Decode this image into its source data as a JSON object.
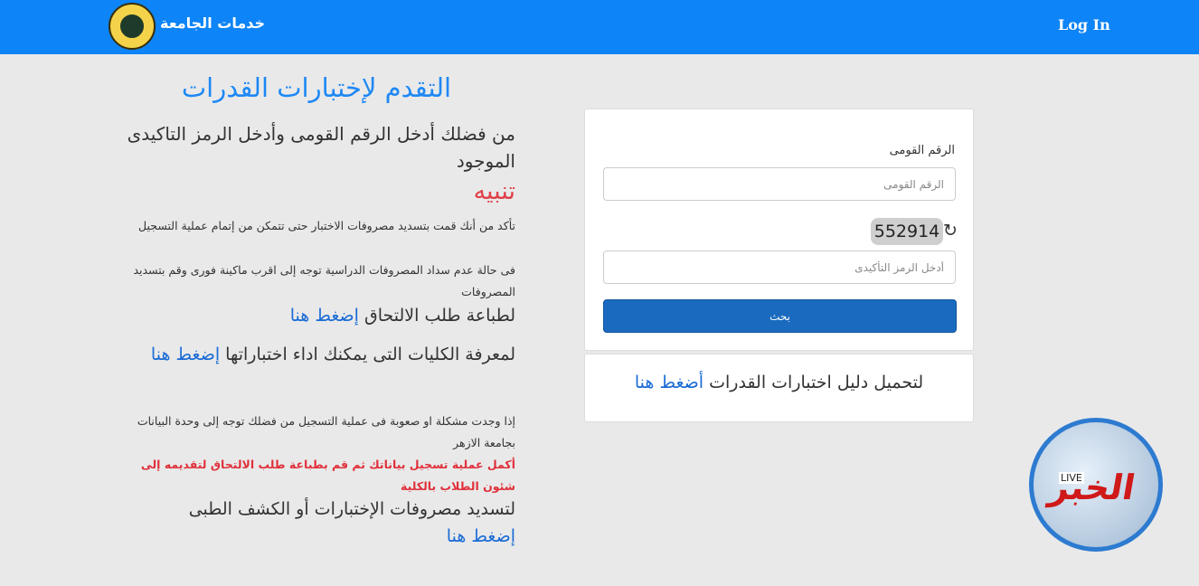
{
  "navbar": {
    "brand": "خدمات الجامعة",
    "login": "Log In",
    "logo_icon": "university-seal"
  },
  "left": {
    "title": "التقدم لإختبارات القدرات",
    "instruction": "من فضلك أدخل الرقم القومى وأدخل الرمز التاكيدى الموجود",
    "warning_title": "تنبيه",
    "warning_1": "تأكد من أنك قمت بتسديد مصروفات الاختبار حتى تتمكن من إتمام عملية التسجيل",
    "warning_2": "فى حالة عدم سداد المصروفات الدراسية توجه إلى اقرب ماكينة فورى وقم بتسديد المصروفات",
    "print_text": "لطباعة طلب الالتحاق",
    "print_link": "إضغط هنا",
    "colleges_text": "لمعرفة الكليات التى يمكنك اداء اختباراتها",
    "colleges_link": "إضغط هنا",
    "problem_text": "إذا وجدت مشكلة او صعوبة فى عملية التسجيل من فضلك توجه إلى وحدة البيانات بجامعة الازهر",
    "complete_text": "أكمل عملية تسجيل بياناتك ثم قم بطباعة طلب الالتحاق لتقديمه إلى شئون الطلاب بالكلية",
    "fees_text": "لتسديد مصروفات الإختبارات أو الكشف الطبى",
    "fees_link": "إضغط هنا"
  },
  "form": {
    "national_id_label": "الرقم القومى",
    "national_id_placeholder": "الرقم القومى",
    "captcha_value": "552914",
    "captcha_placeholder": "أدخل الرمز التأكيدى",
    "submit_label": "بحث",
    "refresh_icon": "refresh-icon"
  },
  "guide": {
    "text": "لتحميل دليل اختبارات القدرات",
    "link": "أضغط هنا"
  },
  "badge": {
    "text": "الخبر",
    "live": "LIVE"
  },
  "colors": {
    "navbar": "#0d84f7",
    "title": "#1e88f5",
    "warning": "#e0404a",
    "button": "#1a6bbf"
  }
}
